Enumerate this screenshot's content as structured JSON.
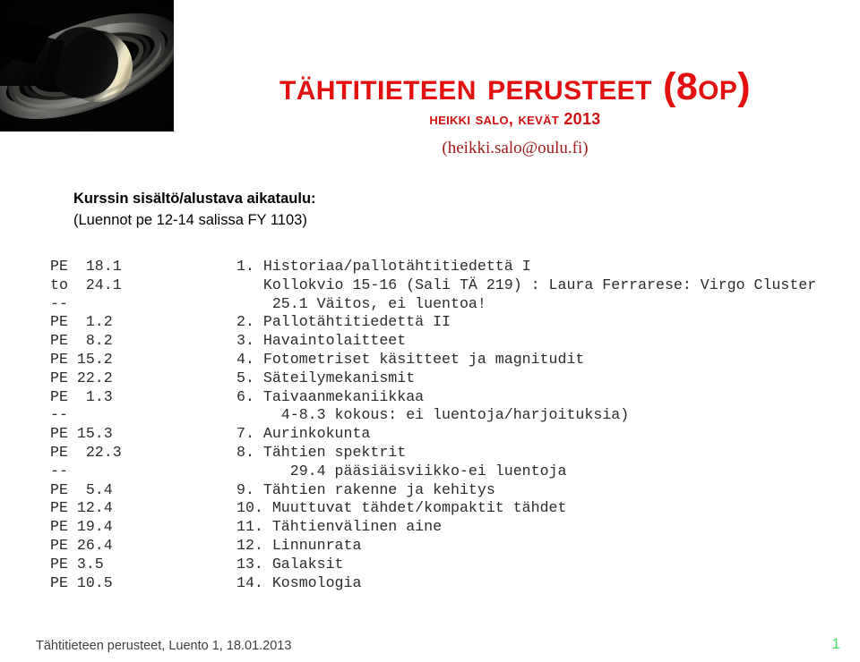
{
  "slide": {
    "background_color": "#ffffff",
    "accent_red": "#e2100f",
    "email_color": "#9e1b1b",
    "page_number_color": "#4bd863"
  },
  "hero_image": {
    "alt": "saturn-photograph",
    "background_color": "#000000"
  },
  "title": {
    "main": "TÄHTITIETEEN PERUSTEET (8OP)",
    "subtitle": "HEIKKI SALO, KEVÄT 2013",
    "email": "(heikki.salo@oulu.fi)"
  },
  "heading": {
    "line1": "Kurssin sisältö/alustava aikataulu:",
    "line2": "(Luennot pe 12-14 salissa FY 1103)"
  },
  "schedule": {
    "rows": [
      {
        "date": "PE  18.1",
        "topic": "1. Historiaa/pallotähtitiedettä I"
      },
      {
        "date": "to  24.1",
        "topic": "   Kollokvio 15-16 (Sali TÄ 219) : Laura Ferrarese: Virgo Cluster"
      },
      {
        "date": "--",
        "topic": "    25.1 Väitos, ei luentoa!"
      },
      {
        "date": "PE  1.2",
        "topic": "2. Pallotähtitiedettä II"
      },
      {
        "date": "PE  8.2",
        "topic": "3. Havaintolaitteet"
      },
      {
        "date": "PE 15.2",
        "topic": "4. Fotometriset käsitteet ja magnitudit"
      },
      {
        "date": "PE 22.2",
        "topic": "5. Säteilymekanismit"
      },
      {
        "date": "PE  1.3",
        "topic": "6. Taivaanmekaniikkaa"
      },
      {
        "date": "--",
        "topic": "     4-8.3 kokous: ei luentoja/harjoituksia)"
      },
      {
        "date": "PE 15.3",
        "topic": "7. Aurinkokunta"
      },
      {
        "date": "PE  22.3",
        "topic": "8. Tähtien spektrit"
      },
      {
        "date": "--",
        "topic": "      29.4 pääsiäisviikko-ei luentoja"
      },
      {
        "date": "PE  5.4",
        "topic": "9. Tähtien rakenne ja kehitys"
      },
      {
        "date": "PE 12.4",
        "topic": "10. Muuttuvat tähdet/kompaktit tähdet"
      },
      {
        "date": "PE 19.4",
        "topic": "11. Tähtienvälinen aine"
      },
      {
        "date": "PE 26.4",
        "topic": "12. Linnunrata"
      },
      {
        "date": "PE 3.5",
        "topic": "13. Galaksit"
      },
      {
        "date": "PE 10.5",
        "topic": "14. Kosmologia"
      }
    ]
  },
  "footer": {
    "text": "Tähtitieteen perusteet, Luento 1, 18.01.2013",
    "page": "1"
  }
}
